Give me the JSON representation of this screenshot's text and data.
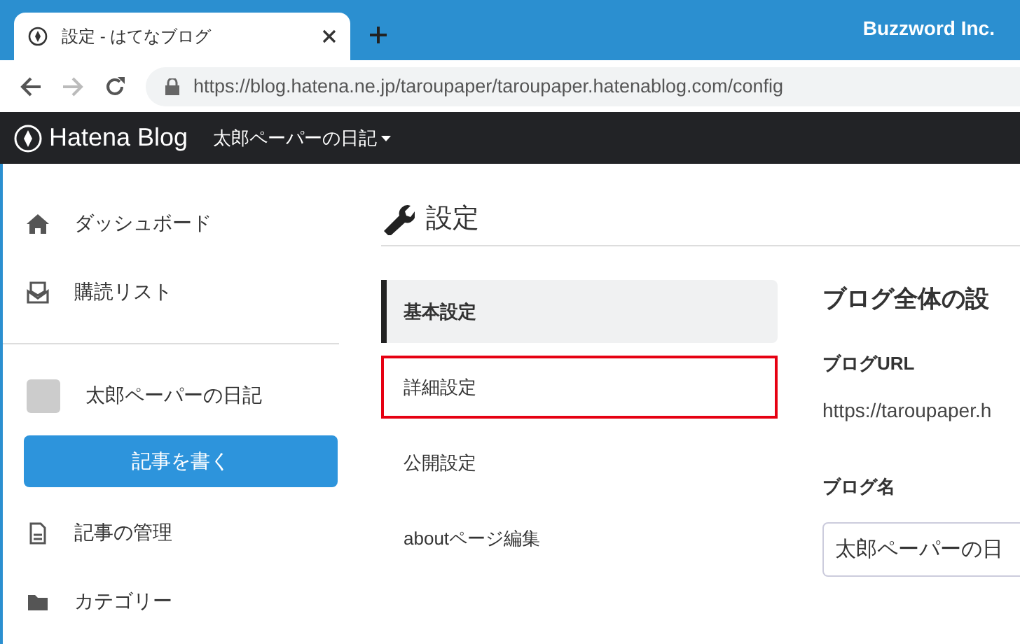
{
  "browser": {
    "tab": {
      "title": "設定 - はてなブログ"
    },
    "profile": "Buzzword Inc.",
    "url": "https://blog.hatena.ne.jp/taroupaper/taroupaper.hatenablog.com/config"
  },
  "navbar": {
    "logo": "Hatena Blog",
    "blog_menu": "太郎ペーパーの日記"
  },
  "sidebar": {
    "top_items": [
      {
        "label": "ダッシュボード"
      },
      {
        "label": "購読リスト"
      }
    ],
    "blog": {
      "name": "太郎ペーパーの日記"
    },
    "write_button": "記事を書く",
    "bottom_items": [
      {
        "label": "記事の管理"
      },
      {
        "label": "カテゴリー"
      }
    ]
  },
  "main": {
    "title": "設定",
    "settings_menu": [
      {
        "label": "基本設定",
        "selected": true,
        "highlighted": false
      },
      {
        "label": "詳細設定",
        "selected": false,
        "highlighted": true
      },
      {
        "label": "公開設定",
        "selected": false,
        "highlighted": false
      },
      {
        "label": "aboutページ編集",
        "selected": false,
        "highlighted": false
      }
    ],
    "panel": {
      "heading": "ブログ全体の設",
      "fields": [
        {
          "label": "ブログURL",
          "kind": "text",
          "value": "https://taroupaper.h"
        },
        {
          "label": "ブログ名",
          "kind": "input",
          "value": "太郎ペーパーの日"
        }
      ]
    }
  }
}
